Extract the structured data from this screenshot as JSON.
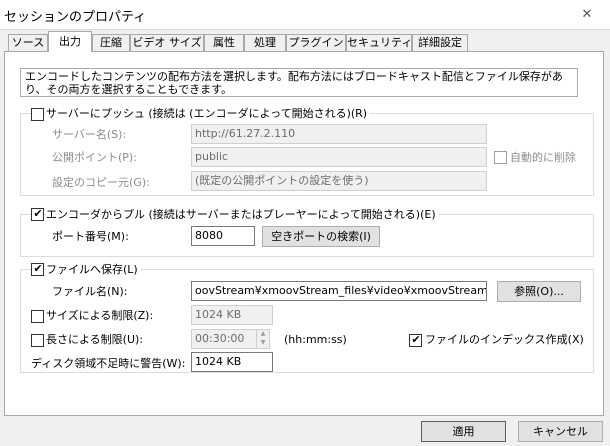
{
  "window": {
    "title": "セッションのプロパティ"
  },
  "tabs": [
    {
      "label": "ソース"
    },
    {
      "label": "出力"
    },
    {
      "label": "圧縮"
    },
    {
      "label": "ビデオ サイズ"
    },
    {
      "label": "属性"
    },
    {
      "label": "処理"
    },
    {
      "label": "プラグイン"
    },
    {
      "label": "セキュリティ"
    },
    {
      "label": "詳細設定"
    }
  ],
  "description": "エンコードしたコンテンツの配布方法を選択します。配布方法にはブロードキャスト配信とファイル保存があり、その両方を選択することもできます。",
  "push": {
    "checkbox_label": "サーバーにプッシュ (接続は (エンコーダによって開始される)(R)",
    "checked": false,
    "server_label": "サーバー名(S):",
    "server_value": "http://61.27.2.110",
    "publish_label": "公開ポイント(P):",
    "publish_value": "public",
    "auto_delete_label": "自動的に削除",
    "copy_label": "設定のコピー元(G):",
    "copy_value": "(既定の公開ポイントの設定を使う)"
  },
  "pull": {
    "checkbox_label": "エンコーダからプル (接続はサーバーまたはプレーヤーによって開始される)(E)",
    "checked": true,
    "port_label": "ポート番号(M):",
    "port_value": "8080",
    "find_port_button": "空きポートの検索(I)"
  },
  "archive": {
    "checkbox_label": "ファイルへ保存(L)",
    "checked": true,
    "filename_label": "ファイル名(N):",
    "filename_value": "oovStream¥xmoovStream_files¥video¥xmoovStream.wmv",
    "browse_button": "参照(O)...",
    "size_limit_label": "サイズによる制限(Z):",
    "size_limit_value": "1024 KB",
    "length_limit_label": "長さによる制限(U):",
    "length_limit_value": "00:30:00",
    "length_unit": "(hh:mm:ss)",
    "index_label": "ファイルのインデックス作成(X)",
    "index_checked": true,
    "disk_warning_label": "ディスク領域不足時に警告(W):",
    "disk_warning_value": "1024 KB"
  },
  "footer": {
    "apply_button": "適用",
    "cancel_button": "キャンセル"
  }
}
